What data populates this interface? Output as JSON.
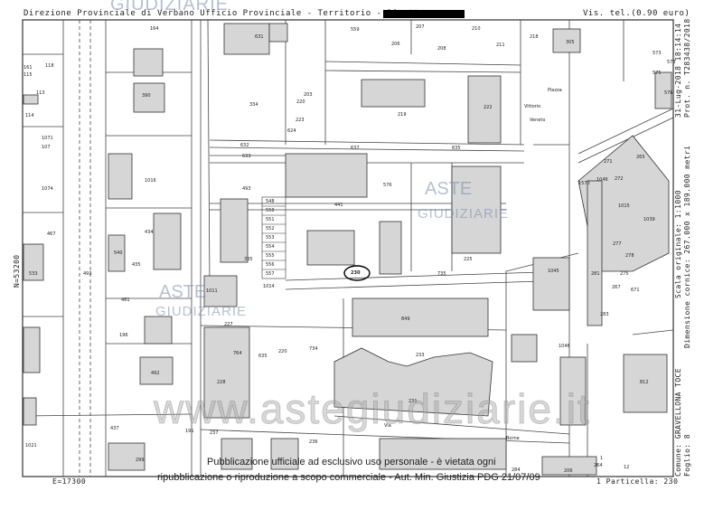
{
  "header": {
    "left": "Direzione Provinciale di Verbano Ufficio Provinciale - Territorio - Direttore",
    "right": "Vis. tel.(0.90 euro)"
  },
  "side_labels": {
    "date": "31-Lug-2018 18:14:14",
    "prot": "Prot. n. T283438/2018",
    "scale": "Scala originale: 1:1000",
    "frame": "Dimensione cornice: 267.000 x 189.000 metri",
    "comune": "Comune: GRAVELLONA TOCE",
    "foglio": "Foglio: 8",
    "north": "N=53200"
  },
  "bottom": {
    "east": "E=17300",
    "particella": "1 Particella: 230"
  },
  "watermarks": {
    "site": "www.astegiudiziarie.it",
    "logo_top": "ASTE",
    "logo_bottom": "GIUDIZIARIE"
  },
  "notice": {
    "line1": "Pubblicazione ufficiale ad esclusivo uso personale - è vietata ogni",
    "line2": "ripubblicazione o riproduzione a scopo commerciale - Aut. Min. Giustizia PDG 21/07/09"
  },
  "map_text": {
    "piazza": "Piazza",
    "vittorio": "Vittorio",
    "veneto": "Veneto",
    "strada1": "Via",
    "strada2": "Borne"
  },
  "parcels": [
    "164",
    "631",
    "559",
    "206",
    "207",
    "208",
    "210",
    "211",
    "218",
    "305",
    "573",
    "575",
    "576",
    "161",
    "578",
    "118",
    "115",
    "113",
    "114",
    "390",
    "334",
    "203",
    "220",
    "219",
    "222",
    "223",
    "624",
    "632",
    "637",
    "635",
    "633",
    "1071",
    "107",
    "1016",
    "1074",
    "493",
    "576",
    "548",
    "550",
    "551",
    "552",
    "553",
    "554",
    "555",
    "556",
    "557",
    "441",
    "434",
    "335",
    "435",
    "540",
    "230",
    "225",
    "735",
    "1014",
    "1011",
    "481",
    "227",
    "764",
    "635",
    "734",
    "849",
    "220",
    "233",
    "492",
    "196",
    "228",
    "231",
    "437",
    "237",
    "236",
    "1045",
    "812",
    "1046",
    "1039",
    "1046",
    "1015",
    "271",
    "265",
    "272",
    "1570",
    "277",
    "278",
    "281",
    "275",
    "671",
    "283",
    "267",
    "264",
    "1",
    "12",
    "299",
    "206",
    "284",
    "1021",
    "533",
    "467",
    "493",
    "191",
    "237"
  ],
  "subject_parcel": "230"
}
